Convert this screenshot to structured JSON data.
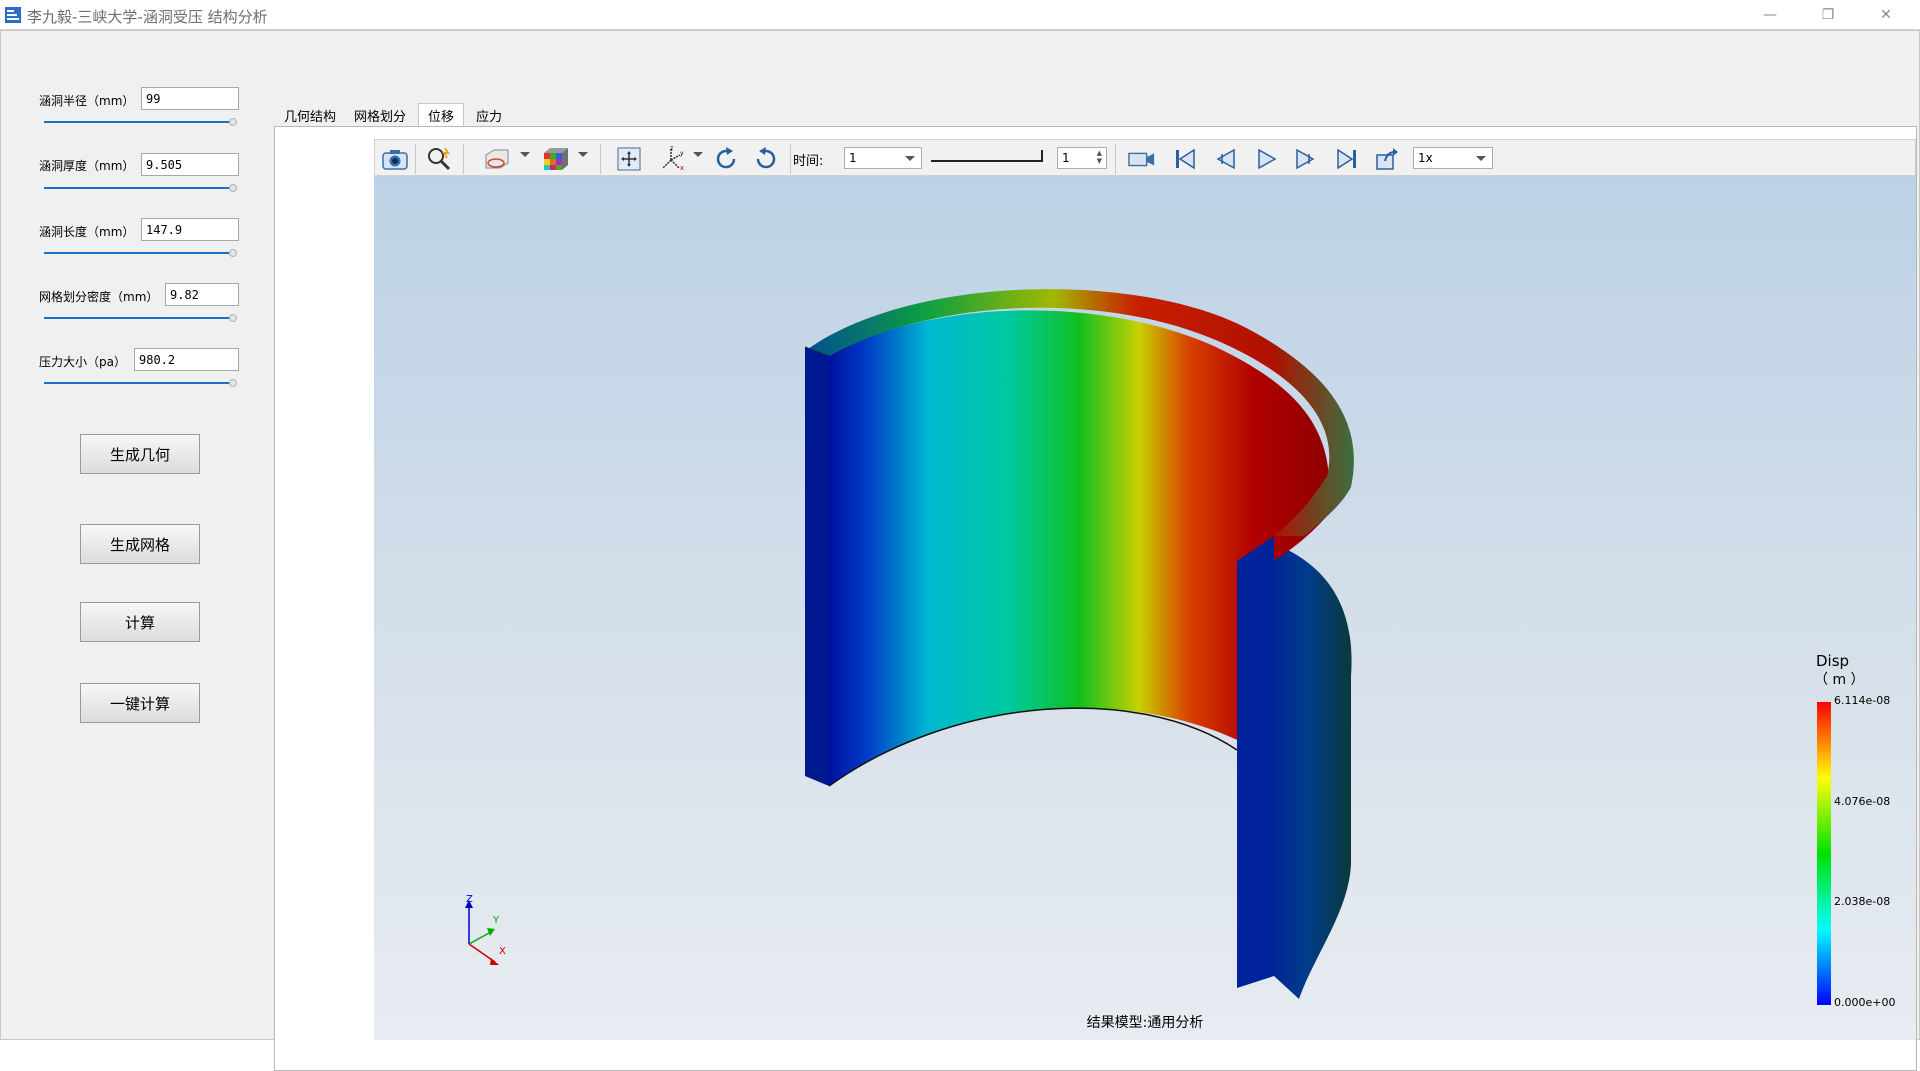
{
  "window": {
    "title": "李九毅-三峡大学-涵洞受压 结构分析",
    "minimize_glyph": "—",
    "maximize_glyph": "❐",
    "close_glyph": "✕"
  },
  "params": [
    {
      "label": "涵洞半径（mm）",
      "value": "99",
      "slider_fraction": 1.0
    },
    {
      "label": "涵洞厚度（mm）",
      "value": "9.505",
      "slider_fraction": 1.0
    },
    {
      "label": "涵洞长度（mm）",
      "value": "147.9",
      "slider_fraction": 1.0
    },
    {
      "label": "网格划分密度（mm）",
      "value": "9.82",
      "slider_fraction": 1.0
    },
    {
      "label": "压力大小（pa）",
      "value": "980.2",
      "slider_fraction": 1.0
    }
  ],
  "buttons": {
    "generate_geometry": "生成几何",
    "generate_mesh": "生成网格",
    "compute": "计算",
    "one_click_compute": "一键计算"
  },
  "tabs": [
    {
      "label": "几何结构",
      "active": false
    },
    {
      "label": "网格划分",
      "active": false
    },
    {
      "label": "位移",
      "active": true
    },
    {
      "label": "应力",
      "active": false
    }
  ],
  "toolbar": {
    "time_label": "时间:",
    "time_value": "1",
    "frame_value": "1",
    "speed_value": "1x",
    "icons": [
      "camera-icon",
      "zoom-icon",
      "view-mode-icon",
      "colormap-icon",
      "fit-view-icon",
      "axes-icon",
      "rotate-cw-icon",
      "rotate-ccw-icon",
      "record-video-icon",
      "first-frame-icon",
      "prev-frame-icon",
      "play-icon",
      "next-frame-icon",
      "last-frame-icon",
      "export-icon"
    ]
  },
  "viewport": {
    "caption": "结果模型:通用分析",
    "triad": {
      "z": "Z",
      "y": "Y",
      "x": "X"
    },
    "legend": {
      "title": "Disp",
      "unit": "（ m ）",
      "ticks": [
        "6.114e-08",
        "4.076e-08",
        "2.038e-08",
        "0.000e+00"
      ],
      "colors": [
        "#ff0000",
        "#ffff00",
        "#00e000",
        "#00ffff",
        "#0000ff"
      ]
    }
  }
}
